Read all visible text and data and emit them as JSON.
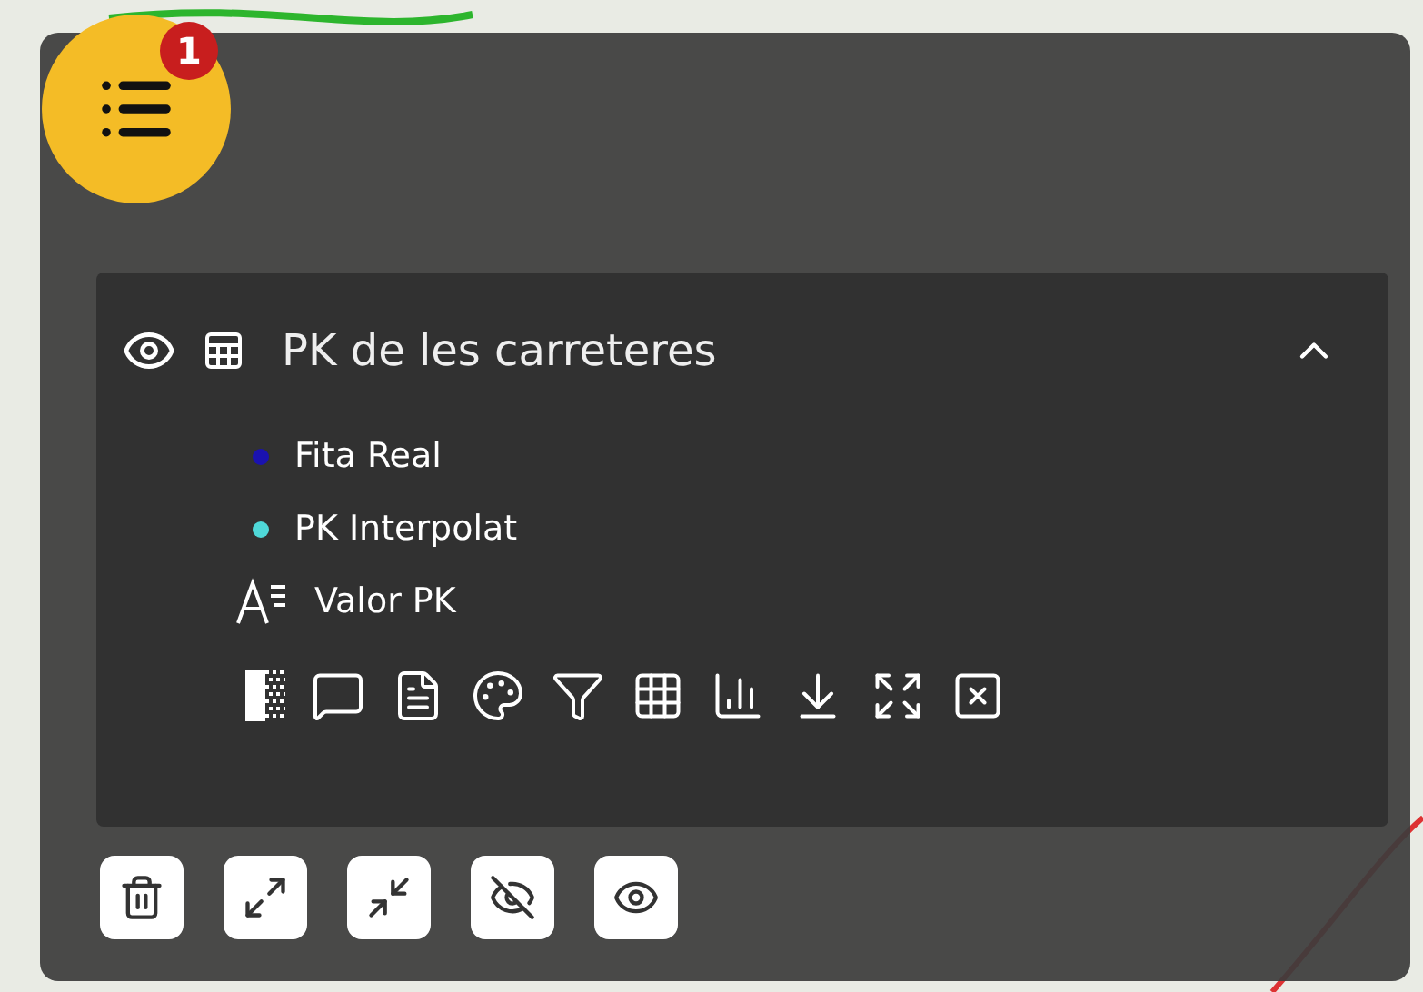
{
  "menu_button": {
    "badge": "1"
  },
  "layer": {
    "title": "PK de les carreteres",
    "expanded": true,
    "legend": [
      {
        "kind": "point",
        "label": "Fita Real",
        "color": "#1a12b0"
      },
      {
        "kind": "point",
        "label": "PK Interpolat",
        "color": "#4fd8d8"
      },
      {
        "kind": "label",
        "label": "Valor PK"
      }
    ]
  }
}
